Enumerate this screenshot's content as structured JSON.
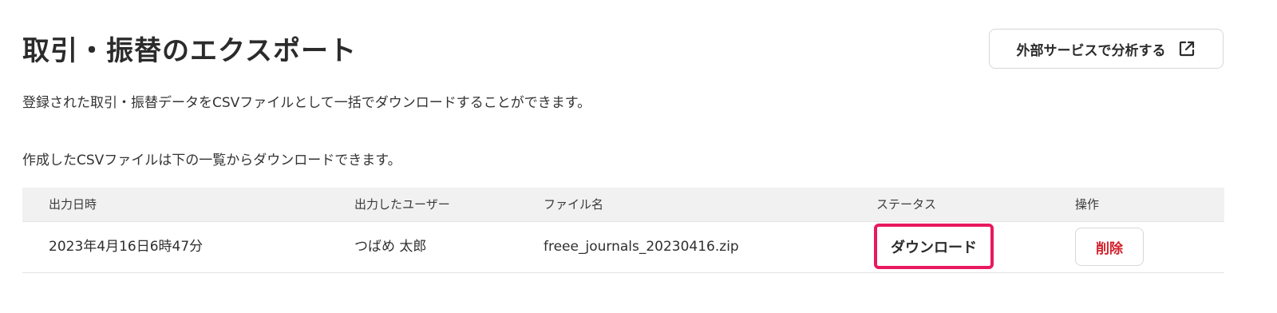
{
  "header": {
    "title": "取引・振替のエクスポート",
    "external_button_label": "外部サービスで分析する",
    "external_icon": "external-link-icon"
  },
  "description": {
    "line1": "登録された取引・振替データをCSVファイルとして一括でダウンロードすることができます。",
    "line2": "作成したCSVファイルは下の一覧からダウンロードできます。"
  },
  "table": {
    "columns": [
      "出力日時",
      "出力したユーザー",
      "ファイル名",
      "ステータス",
      "操作"
    ],
    "rows": [
      {
        "date": "2023年4月16日6時47分",
        "user": "つばめ 太郎",
        "filename": "freee_journals_20230416.zip",
        "status": "ダウンロード",
        "action": "削除"
      }
    ]
  },
  "colors": {
    "highlight": "#e8195f",
    "delete": "#d31f2a",
    "header_bg": "#f2f1f1"
  }
}
